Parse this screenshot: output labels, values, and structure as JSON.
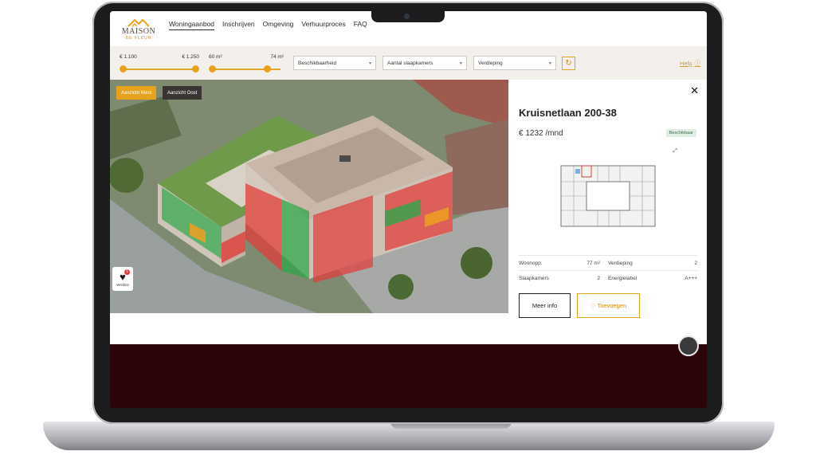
{
  "site": {
    "logo": {
      "line1": "MAISON",
      "line2": "DE FLEUR"
    },
    "nav": [
      "Woningaanbod",
      "Inschrijven",
      "Omgeving",
      "Verhuurproces",
      "FAQ"
    ],
    "nav_active": 0
  },
  "filters": {
    "price": {
      "min": "€ 1.100",
      "max": "€ 1.250",
      "low": 0.0,
      "high": 1.0
    },
    "area": {
      "min": "60 m²",
      "max": "74 m²",
      "low": 0.0,
      "high": 1.0
    },
    "selects": [
      "Beschikbaarheid",
      "Aantal slaapkamers",
      "Verdieping"
    ],
    "help": "Help",
    "help_icon": "question-circle-icon"
  },
  "viewer": {
    "tabs": [
      "Aanzicht West",
      "Aanzicht Oost"
    ],
    "active_tab": 0,
    "wishlist_label": "Wishlist",
    "wishlist_count": "1",
    "colors": {
      "available": "#2fa64a",
      "rented": "#e23d3a",
      "option": "#f0a020",
      "accent": "#e6a21c"
    }
  },
  "panel": {
    "title": "Kruisnetlaan 200-38",
    "price": "€ 1232 /mnd",
    "status": "Beschikbaar",
    "specs": [
      {
        "label": "Woonopp.",
        "value": "77 m²",
        "label2": "Verdieping",
        "value2": "2"
      },
      {
        "label": "Slaapkamers",
        "value": "2",
        "label2": "Energielabel",
        "value2": "A+++"
      }
    ],
    "more_info": "Meer info",
    "add": "♡ Toevoegen"
  }
}
